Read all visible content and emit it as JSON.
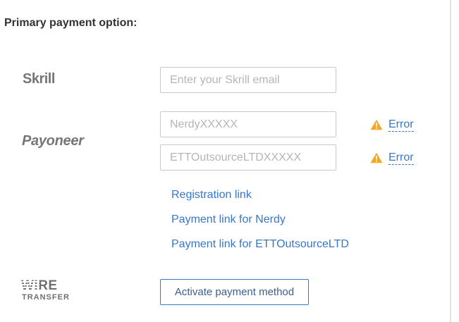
{
  "section": {
    "title": "Primary payment option:"
  },
  "logos": {
    "skrill": "Skrill",
    "payoneer": "Payoneer",
    "wire_top": "WIRE",
    "wire_bottom": "TRANSFER"
  },
  "skrill": {
    "email_value": "",
    "email_placeholder": "Enter your Skrill email"
  },
  "payoneer": {
    "nerdy_value": "",
    "nerdy_placeholder": "NerdyXXXXX",
    "ett_value": "",
    "ett_placeholder": "ETTOutsourceLTDXXXXX",
    "nerdy_error": "Error",
    "ett_error": "Error"
  },
  "links": {
    "registration": "Registration link",
    "payment_nerdy": "Payment link for Nerdy",
    "payment_ett": "Payment link for ETTOutsourceLTD"
  },
  "wire": {
    "activate_label": "Activate payment method"
  },
  "icons": {
    "warning": "warning-triangle-icon"
  },
  "colors": {
    "link": "#3777c8",
    "warning": "#f5a623",
    "logo_gray": "#767676",
    "border": "#c9c9c9"
  }
}
